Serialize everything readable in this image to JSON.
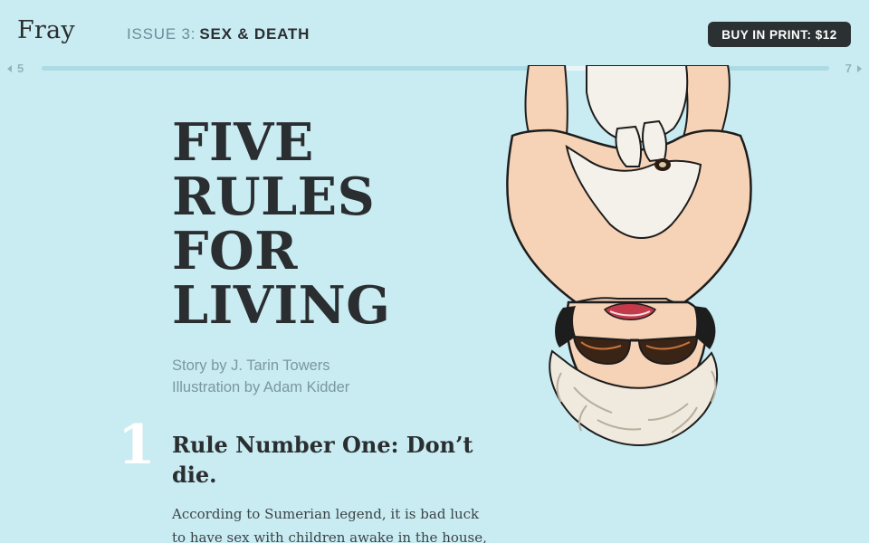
{
  "header": {
    "logo": "Fray",
    "issue_label": "ISSUE 3:",
    "issue_title": "SEX & DEATH",
    "buy_button": "BUY IN PRINT: $12"
  },
  "pager": {
    "prev_page": "5",
    "next_page": "7",
    "progress": 0.62
  },
  "article": {
    "headline_lines": [
      "FIVE",
      "RULES",
      "FOR",
      "LIVING"
    ],
    "story_credit": "Story by J. Tarin Towers",
    "illustration_credit": "Illustration by Adam Kidder",
    "rule_number": "1",
    "rule_title": "Rule Number One: Don’t die.",
    "body_lines": [
      "According to Sumerian legend, it is bad luck",
      "to have sex with children awake in the house,"
    ]
  },
  "illustration": {
    "icon": "upside-down-woman-holding-cat-illustration",
    "colors": {
      "skin": "#f6d3b6",
      "hair": "#efe9de",
      "outline": "#1d1d1d",
      "lips": "#c43a4a",
      "glasses": "#3a2416"
    }
  },
  "colors": {
    "background": "#c9ebf2",
    "text_dark": "#2a2e30",
    "text_muted": "#7a98a2",
    "button_bg": "#2b3133"
  }
}
